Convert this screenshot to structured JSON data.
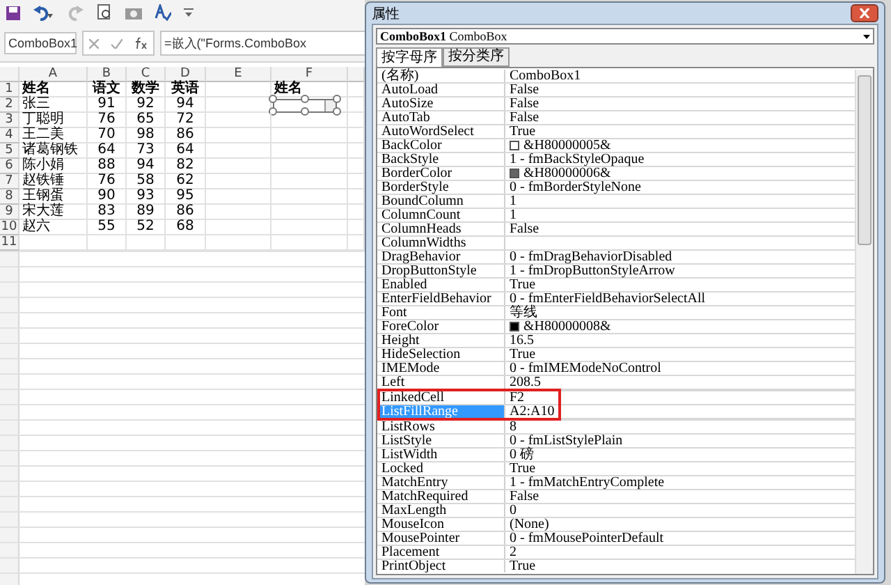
{
  "toolbar": {
    "name_box": "ComboBox1",
    "formula": "=嵌入(\"Forms.ComboBox"
  },
  "sheet": {
    "columns": [
      "A",
      "B",
      "C",
      "D",
      "E",
      "F"
    ],
    "rows": [
      {
        "number": "1",
        "cells": [
          "姓名",
          "语文",
          "数学",
          "英语"
        ]
      },
      {
        "number": "2",
        "cells": [
          "张三",
          "91",
          "92",
          "94"
        ]
      },
      {
        "number": "3",
        "cells": [
          "丁聪明",
          "76",
          "65",
          "72"
        ]
      },
      {
        "number": "4",
        "cells": [
          "王二美",
          "70",
          "98",
          "86"
        ]
      },
      {
        "number": "5",
        "cells": [
          "诸葛钢铁",
          "64",
          "73",
          "64"
        ]
      },
      {
        "number": "6",
        "cells": [
          "陈小娟",
          "88",
          "94",
          "82"
        ]
      },
      {
        "number": "7",
        "cells": [
          "赵铁锤",
          "76",
          "58",
          "62"
        ]
      },
      {
        "number": "8",
        "cells": [
          "王钢蛋",
          "90",
          "93",
          "95"
        ]
      },
      {
        "number": "9",
        "cells": [
          "宋大莲",
          "83",
          "89",
          "86"
        ]
      },
      {
        "number": "10",
        "cells": [
          "赵六",
          "55",
          "52",
          "68"
        ]
      },
      {
        "number": "11",
        "cells": []
      }
    ],
    "column_f_label": "姓名",
    "combo_box": {
      "selected": true
    }
  },
  "properties": {
    "title": "属性",
    "object": "**ComboBox1** ComboBox",
    "tabs": [
      {
        "label": "按字母序",
        "selected": true
      },
      {
        "label": "按分类序",
        "selected": false
      }
    ],
    "rows": [
      {
        "name": "(名称)",
        "value": "ComboBox1",
        "selected": false,
        "highlighted": false
      },
      {
        "name": "AutoLoad",
        "value": "False",
        "selected": false,
        "highlighted": false
      },
      {
        "name": "AutoSize",
        "value": "False",
        "selected": false,
        "highlighted": false
      },
      {
        "name": "AutoTab",
        "value": "False",
        "selected": false,
        "highlighted": false
      },
      {
        "name": "AutoWordSelect",
        "value": "True",
        "selected": false,
        "highlighted": false
      },
      {
        "name": "BackColor",
        "value": "&H80000005&",
        "color": "#ffffff",
        "selected": false,
        "highlighted": false
      },
      {
        "name": "BackStyle",
        "value": "1 - fmBackStyleOpaque",
        "selected": false,
        "highlighted": false
      },
      {
        "name": "BorderColor",
        "value": "&H80000006&",
        "color": "#646464",
        "selected": false,
        "highlighted": false
      },
      {
        "name": "BorderStyle",
        "value": "0 - fmBorderStyleNone",
        "selected": false,
        "highlighted": false
      },
      {
        "name": "BoundColumn",
        "value": "1",
        "selected": false,
        "highlighted": false
      },
      {
        "name": "ColumnCount",
        "value": "1",
        "selected": false,
        "highlighted": false
      },
      {
        "name": "ColumnHeads",
        "value": "False",
        "selected": false,
        "highlighted": false
      },
      {
        "name": "ColumnWidths",
        "selected": false,
        "highlighted": false
      },
      {
        "name": "DragBehavior",
        "value": "0 - fmDragBehaviorDisabled",
        "selected": false,
        "highlighted": false
      },
      {
        "name": "DropButtonStyle",
        "value": "1 - fmDropButtonStyleArrow",
        "selected": false,
        "highlighted": false
      },
      {
        "name": "Enabled",
        "value": "True",
        "selected": false,
        "highlighted": false
      },
      {
        "name": "EnterFieldBehavior",
        "value": "0 - fmEnterFieldBehaviorSelectAll",
        "selected": false,
        "highlighted": false
      },
      {
        "name": "Font",
        "value": "等线",
        "selected": false,
        "highlighted": false
      },
      {
        "name": "ForeColor",
        "value": "&H80000008&",
        "color": "#000000",
        "selected": false,
        "highlighted": false
      },
      {
        "name": "Height",
        "value": "16.5",
        "selected": false,
        "highlighted": false
      },
      {
        "name": "HideSelection",
        "value": "True",
        "selected": false,
        "highlighted": false
      },
      {
        "name": "IMEMode",
        "value": "0 - fmIMEModeNoControl",
        "selected": false,
        "highlighted": false
      },
      {
        "name": "Left",
        "value": "208.5",
        "selected": false,
        "highlighted": false
      },
      {
        "name": "LinkedCell",
        "value": "F2",
        "selected": false,
        "highlighted": true
      },
      {
        "name": "ListFillRange",
        "value": "A2:A10",
        "selected": true,
        "highlighted": true
      },
      {
        "name": "ListRows",
        "value": "8",
        "selected": false,
        "highlighted": false
      },
      {
        "name": "ListStyle",
        "value": "0 - fmListStylePlain",
        "selected": false,
        "highlighted": false
      },
      {
        "name": "ListWidth",
        "value": "0 磅",
        "selected": false,
        "highlighted": false
      },
      {
        "name": "Locked",
        "value": "True",
        "selected": false,
        "highlighted": false
      },
      {
        "name": "MatchEntry",
        "value": "1 - fmMatchEntryComplete",
        "selected": false,
        "highlighted": false
      },
      {
        "name": "MatchRequired",
        "value": "False",
        "selected": false,
        "highlighted": false
      },
      {
        "name": "MaxLength",
        "value": "0",
        "selected": false,
        "highlighted": false
      },
      {
        "name": "MouseIcon",
        "value": "(None)",
        "selected": false,
        "highlighted": false
      },
      {
        "name": "MousePointer",
        "value": "0 - fmMousePointerDefault",
        "selected": false,
        "highlighted": false
      },
      {
        "name": "Placement",
        "value": "2",
        "selected": false,
        "highlighted": false
      },
      {
        "name": "PrintObject",
        "value": "True",
        "selected": false,
        "highlighted": false
      }
    ]
  }
}
